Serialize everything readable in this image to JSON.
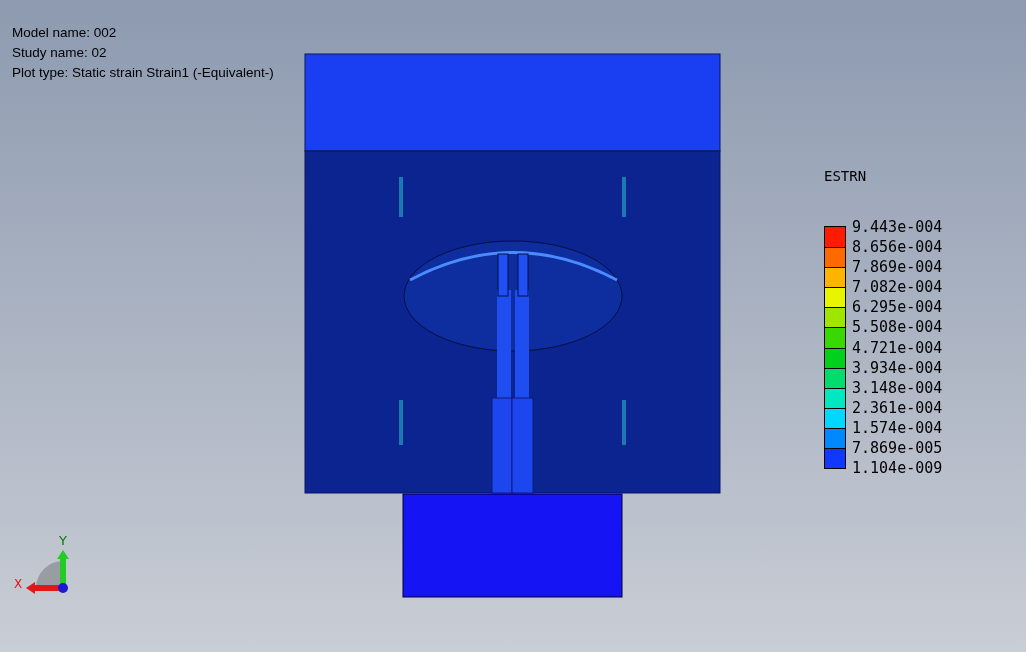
{
  "header": {
    "lines": [
      "Model name: 002",
      "Study name: 02",
      "Plot type: Static strain Strain1 (-Equivalent-)"
    ]
  },
  "legend": {
    "title": "ESTRN",
    "labels": [
      "9.443e-004",
      "8.656e-004",
      "7.869e-004",
      "7.082e-004",
      "6.295e-004",
      "5.508e-004",
      "4.721e-004",
      "3.934e-004",
      "3.148e-004",
      "2.361e-004",
      "1.574e-004",
      "7.869e-005",
      "1.104e-009"
    ],
    "bands": [
      {
        "color": "#ff1a00"
      },
      {
        "color": "#ff6a00"
      },
      {
        "color": "#ffb400"
      },
      {
        "color": "#e8f500"
      },
      {
        "color": "#9ee600"
      },
      {
        "color": "#38d800"
      },
      {
        "color": "#00d21c"
      },
      {
        "color": "#00dc6e"
      },
      {
        "color": "#00e8c0"
      },
      {
        "color": "#00d8ff"
      },
      {
        "color": "#0088ff"
      },
      {
        "color": "#1038ff"
      }
    ]
  },
  "triad": {
    "x_label": "X",
    "y_label": "Y"
  }
}
